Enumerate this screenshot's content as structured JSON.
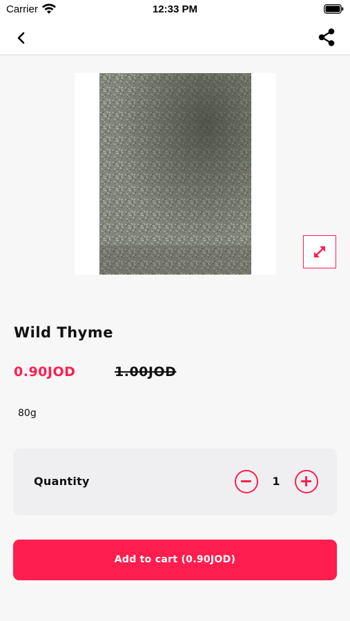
{
  "status_bar": {
    "carrier": "Carrier",
    "time": "12:33 PM",
    "wifi_icon": "wifi-icon",
    "battery_icon": "battery-icon"
  },
  "nav": {
    "back_icon": "chevron-left-icon",
    "share_icon": "share-icon"
  },
  "product": {
    "image_alt": "dried wild thyme herbs",
    "expand_icon": "expand-arrows-icon",
    "title": "Wild Thyme",
    "price_current": "0.90JOD",
    "price_old": "1.00JOD",
    "weight": "80g"
  },
  "quantity": {
    "label": "Quantity",
    "value": "1",
    "minus_icon": "minus-circle-icon",
    "plus_icon": "plus-circle-icon"
  },
  "cart": {
    "button_label": "Add to cart (0.90JOD)"
  },
  "colors": {
    "accent": "#ff1e4e",
    "background": "#f7f7f8",
    "card": "#efeff1"
  }
}
